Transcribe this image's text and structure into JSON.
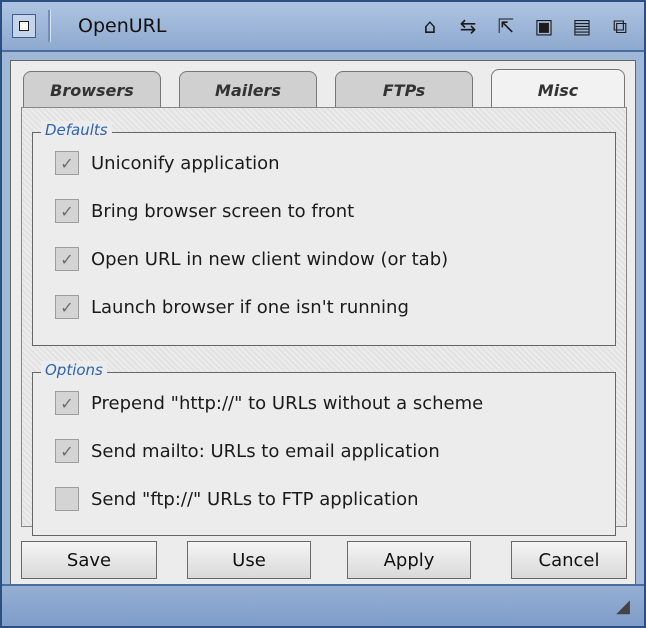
{
  "window": {
    "title": "OpenURL"
  },
  "tabs": [
    {
      "label": "Browsers"
    },
    {
      "label": "Mailers"
    },
    {
      "label": "FTPs"
    },
    {
      "label": "Misc"
    }
  ],
  "defaults": {
    "title": "Defaults",
    "items": [
      {
        "label": "Uniconify application",
        "checked": true
      },
      {
        "label": "Bring browser screen to front",
        "checked": true
      },
      {
        "label": "Open URL in new client window (or tab)",
        "checked": true
      },
      {
        "label": "Launch browser if one isn't running",
        "checked": true
      }
    ]
  },
  "options": {
    "title": "Options",
    "items": [
      {
        "label": "Prepend \"http://\" to URLs without a scheme",
        "checked": true
      },
      {
        "label": "Send mailto: URLs to email application",
        "checked": true
      },
      {
        "label": "Send \"ftp://\" URLs to FTP application",
        "checked": false
      }
    ]
  },
  "buttons": {
    "save": "Save",
    "use": "Use",
    "apply": "Apply",
    "cancel": "Cancel"
  },
  "icons": {
    "titlebar": [
      "window-menu-icon",
      "iconify-icon",
      "snapshot-icon",
      "maximize-icon",
      "zoom-icon",
      "depth-icon"
    ]
  }
}
